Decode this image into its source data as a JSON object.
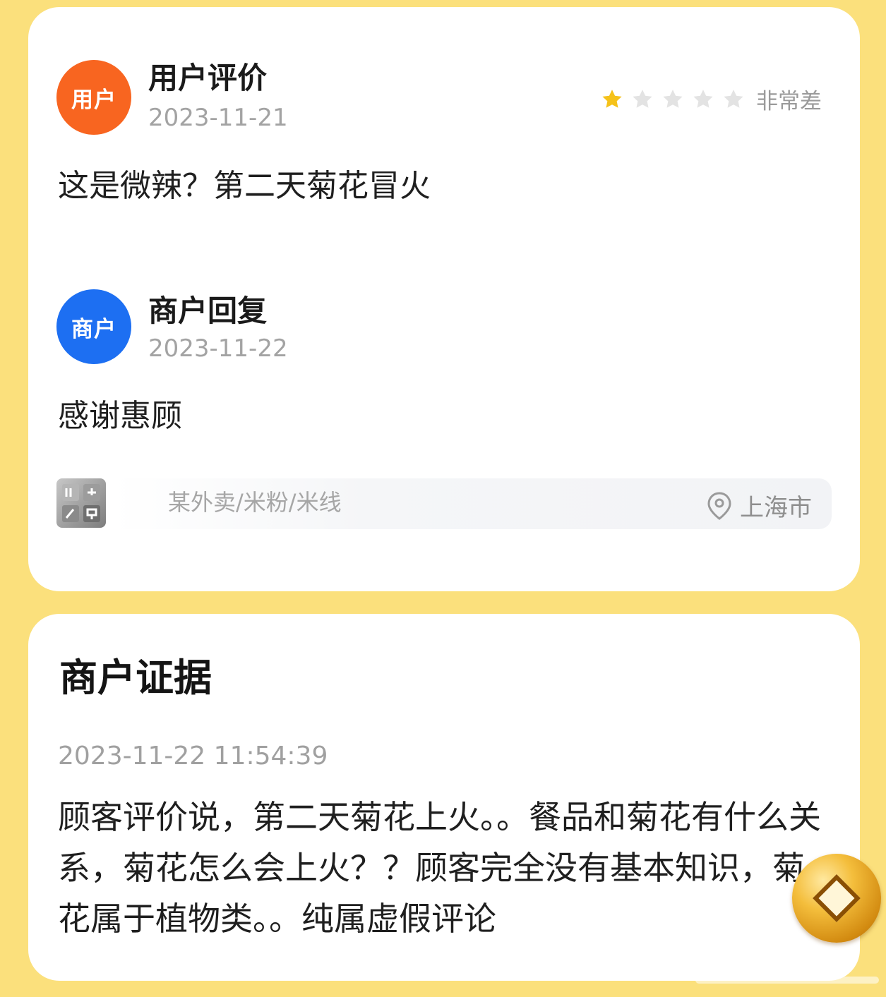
{
  "review": {
    "user_avatar_label": "用户",
    "title": "用户评价",
    "date": "2023-11-21",
    "rating": 1,
    "rating_max": 5,
    "rating_label": "非常差",
    "text": "这是微辣？第二天菊花冒火"
  },
  "reply": {
    "merchant_avatar_label": "商户",
    "title": "商户回复",
    "date": "2023-11-22",
    "text": "感谢惠顾"
  },
  "store": {
    "category": "某外卖/米粉/米线",
    "location": "上海市",
    "icon": "store-thumbnail"
  },
  "evidence": {
    "title": "商户证据",
    "timestamp": "2023-11-22 11:54:39",
    "text": "顾客评价说，第二天菊花上火。。餐品和菊花有什么关系，菊花怎么会上火？？顾客完全没有基本知识，菊花属于植物类。。纯属虚假评论"
  },
  "colors": {
    "background": "#fbe07c",
    "user_avatar": "#f86520",
    "merchant_avatar": "#1d6ff2",
    "star_filled": "#f5c21a",
    "star_empty": "#e3e3e3"
  }
}
